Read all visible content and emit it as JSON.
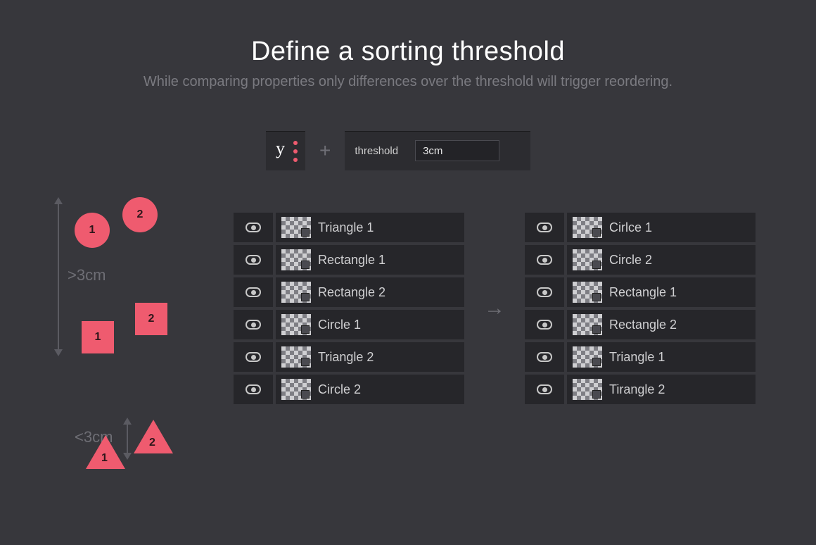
{
  "title": "Define a sorting threshold",
  "subtitle": "While comparing properties only differences over the threshold will trigger reordering.",
  "controls": {
    "y_letter": "y",
    "plus": "+",
    "threshold_label": "threshold",
    "threshold_value": "3cm"
  },
  "shapes": {
    "circle1": "1",
    "circle2": "2",
    "square1": "1",
    "square2": "2",
    "triangle1": "1",
    "triangle2": "2",
    "measure_over": ">3cm",
    "measure_under": "<3cm"
  },
  "arrow": "→",
  "left_list": [
    "Triangle 1",
    "Rectangle 1",
    "Rectangle 2",
    "Circle 1",
    "Triangle 2",
    "Circle 2"
  ],
  "right_list": [
    "Cirlce 1",
    "Circle 2",
    "Rectangle 1",
    "Rectangle 2",
    "Triangle 1",
    "Tirangle 2"
  ]
}
